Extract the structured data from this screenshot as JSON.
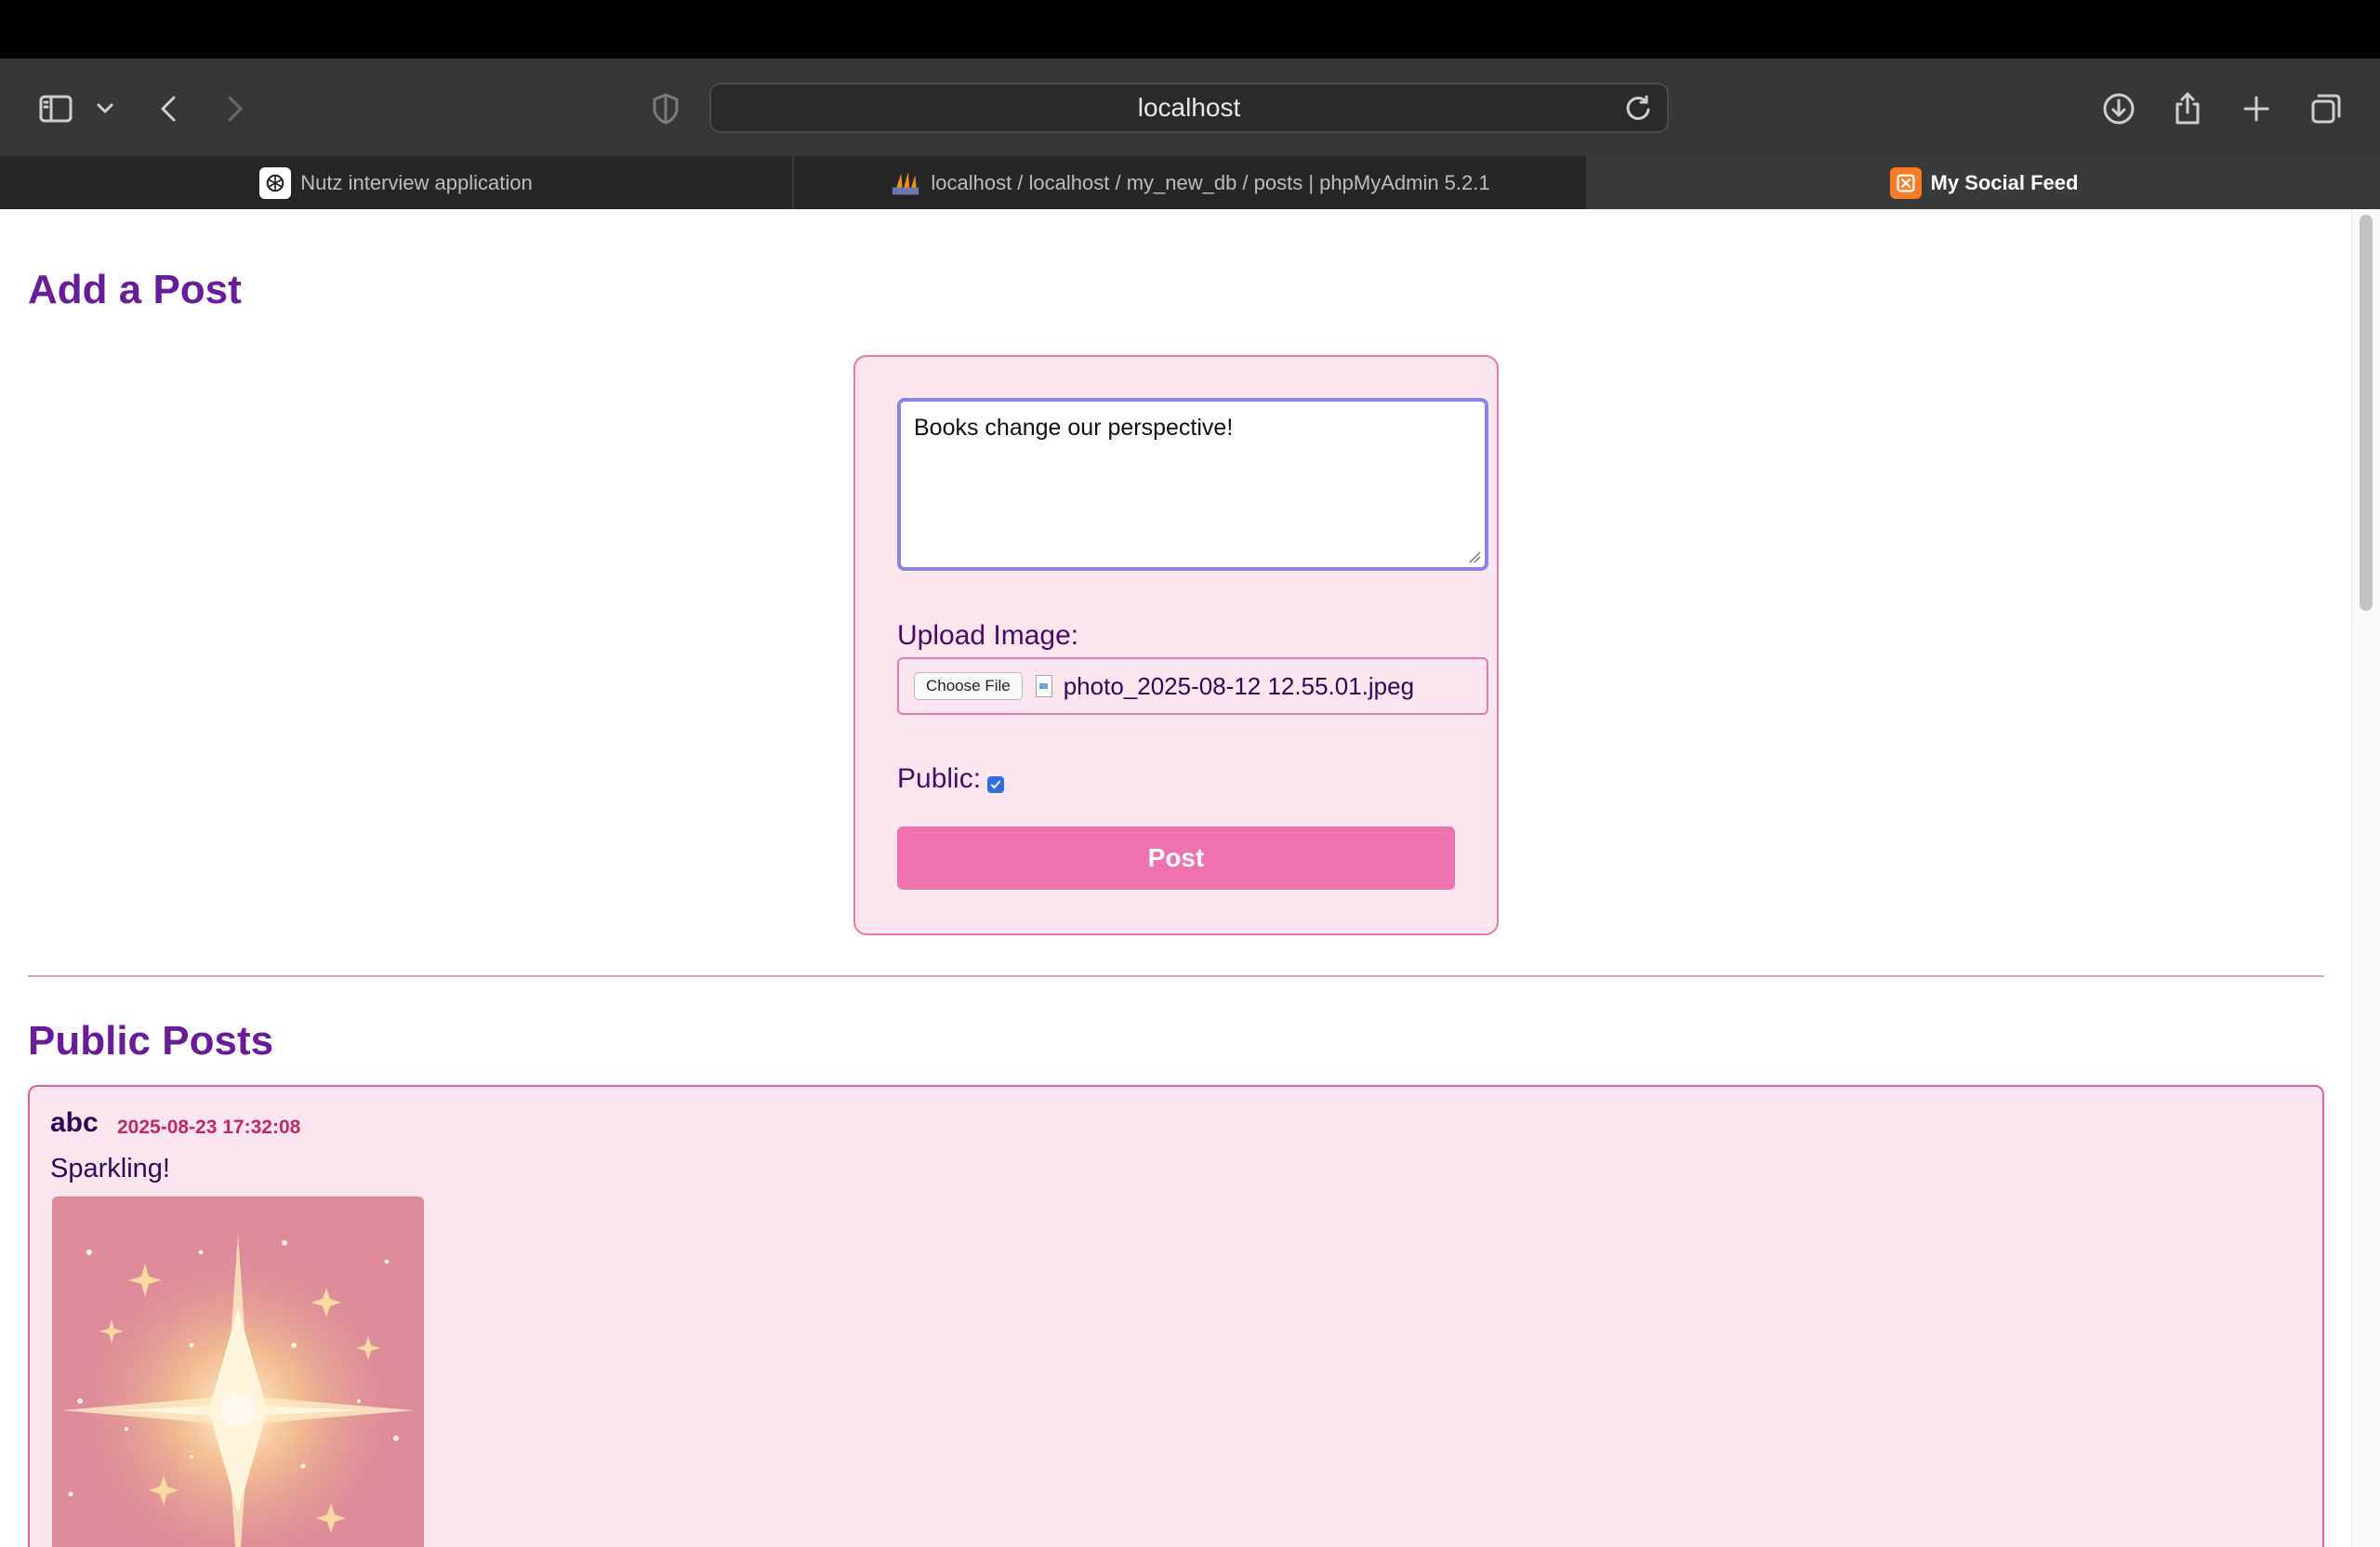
{
  "browser": {
    "url": "localhost",
    "tabs": [
      {
        "label": "Nutz interview application",
        "active": false,
        "icon": "openai-icon"
      },
      {
        "label": "localhost / localhost / my_new_db / posts | phpMyAdmin 5.2.1",
        "active": false,
        "icon": "phpmyadmin-icon"
      },
      {
        "label": "My Social Feed",
        "active": true,
        "icon": "xampp-icon"
      }
    ]
  },
  "add_post": {
    "heading": "Add a Post",
    "textarea_value": "Books change our perspective!",
    "upload_label": "Upload Image:",
    "choose_file_label": "Choose File",
    "file_name": "photo_2025-08-12 12.55.01.jpeg",
    "public_label": "Public:",
    "public_checked": true,
    "post_button": "Post"
  },
  "public_posts": {
    "heading": "Public Posts",
    "posts": [
      {
        "author": "abc",
        "timestamp": "2025-08-23 17:32:08",
        "text": "Sparkling!",
        "image": "sparkle-image"
      }
    ]
  },
  "colors": {
    "accent_purple": "#6a1b9a",
    "pink_border": "#e87aab",
    "card_bg": "#fbe6ef",
    "button_pink": "#ee72b0",
    "timestamp_color": "#c0286a"
  }
}
